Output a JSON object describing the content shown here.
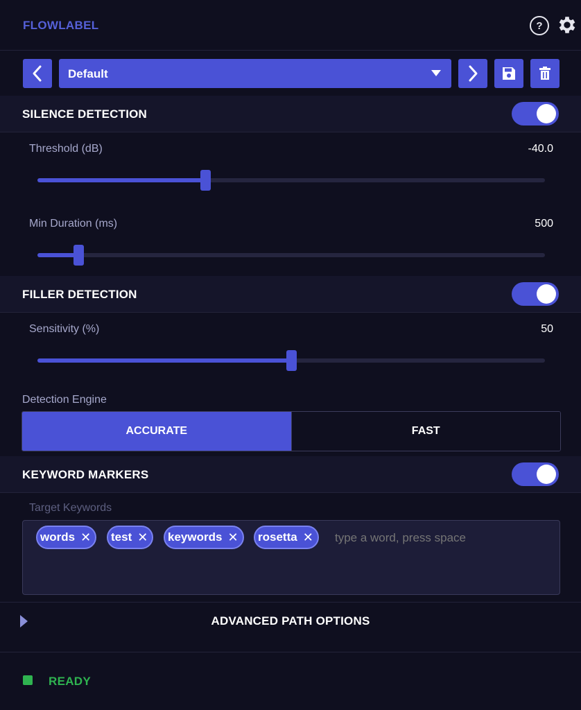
{
  "app": {
    "title": "FLOWLABEL",
    "help_glyph": "?"
  },
  "preset": {
    "selected": "Default"
  },
  "silence": {
    "title": "SILENCE DETECTION",
    "enabled": true,
    "threshold": {
      "label": "Threshold (dB)",
      "value": "-40.0",
      "level": 0.33
    },
    "min_duration": {
      "label": "Min Duration (ms)",
      "value": "500",
      "level": 0.08
    }
  },
  "filler": {
    "title": "FILLER DETECTION",
    "enabled": true,
    "sensitivity": {
      "label": "Sensitivity (%)",
      "value": "50",
      "level": 0.5
    },
    "engine_label": "Detection Engine",
    "engine_options": [
      "ACCURATE",
      "FAST"
    ],
    "engine_selected": "ACCURATE"
  },
  "keywords": {
    "title": "KEYWORD MARKERS",
    "enabled": true,
    "label": "Target Keywords",
    "tags": [
      "words",
      "test",
      "keywords",
      "rosetta"
    ],
    "placeholder": "type a word, press space",
    "remove_glyph": "✕"
  },
  "advanced": {
    "title": "ADVANCED PATH OPTIONS"
  },
  "status": {
    "text": "READY",
    "color": "#2fb350"
  },
  "colors": {
    "accent": "#4a52d6",
    "background": "#0f0f1f",
    "title": "#5560d8"
  },
  "icons": [
    "help-icon",
    "gear-icon",
    "chevron-left-icon",
    "chevron-right-icon",
    "save-icon",
    "trash-icon",
    "dropdown-caret-icon",
    "close-icon",
    "expand-triangle-icon",
    "status-dot-icon"
  ]
}
